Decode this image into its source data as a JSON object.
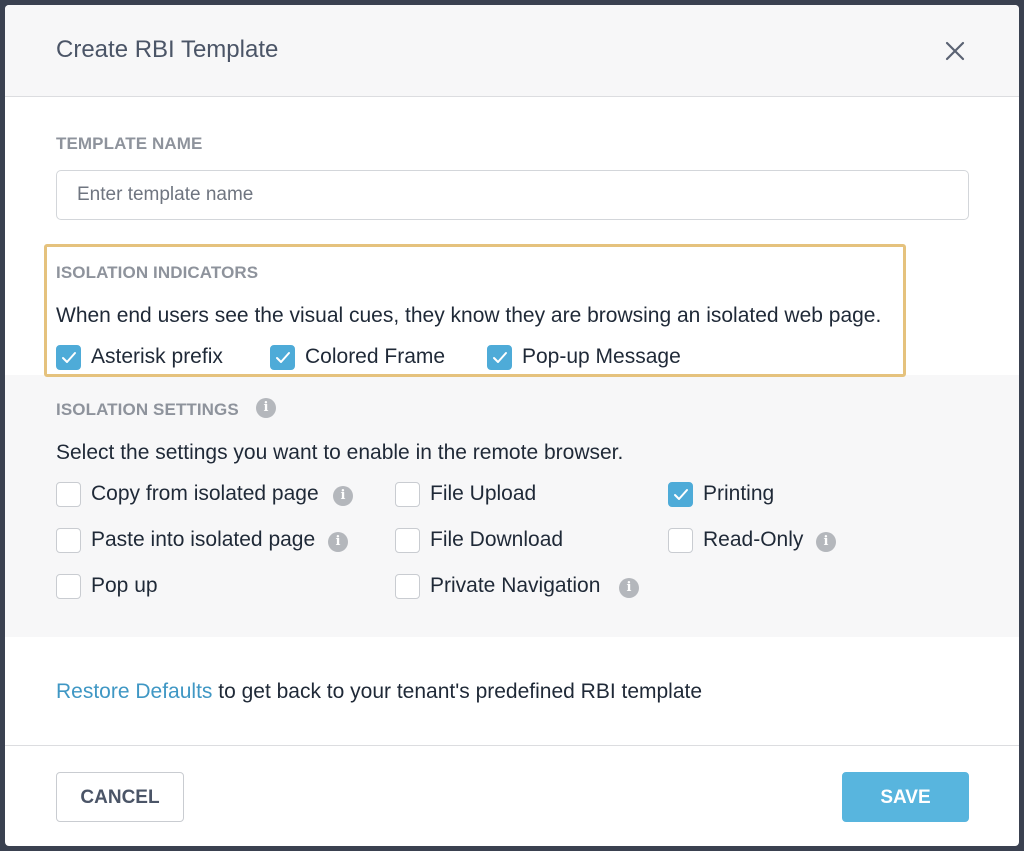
{
  "dialog": {
    "title": "Create RBI Template",
    "close_icon": "close-icon"
  },
  "template_name": {
    "label": "TEMPLATE NAME",
    "value": "",
    "placeholder": "Enter template name"
  },
  "isolation_indicators": {
    "label": "ISOLATION INDICATORS",
    "description": "When end users see the visual cues, they know they are browsing an isolated web page.",
    "highlight_color": "#e5c27d",
    "options": [
      {
        "label": "Asterisk prefix",
        "checked": true
      },
      {
        "label": "Colored Frame",
        "checked": true
      },
      {
        "label": "Pop-up Message",
        "checked": true
      }
    ]
  },
  "isolation_settings": {
    "label": "ISOLATION SETTINGS",
    "description": "Select the settings you want to enable in the remote browser.",
    "options": [
      {
        "label": "Copy from isolated page",
        "checked": false,
        "info": true
      },
      {
        "label": "Paste into isolated page",
        "checked": false,
        "info": true
      },
      {
        "label": "Pop up",
        "checked": false,
        "info": false
      },
      {
        "label": "File Upload",
        "checked": false,
        "info": false
      },
      {
        "label": "File Download",
        "checked": false,
        "info": false
      },
      {
        "label": "Private Navigation",
        "checked": false,
        "info": true
      },
      {
        "label": "Printing",
        "checked": true,
        "info": false
      },
      {
        "label": "Read-Only",
        "checked": false,
        "info": true
      }
    ]
  },
  "restore": {
    "link_text": "Restore Defaults",
    "suffix_text": " to get back to your tenant's predefined RBI template"
  },
  "footer": {
    "cancel_label": "CANCEL",
    "save_label": "SAVE"
  },
  "colors": {
    "accent": "#4eabd8",
    "save_button": "#58b5de",
    "link": "#3f97c4"
  }
}
